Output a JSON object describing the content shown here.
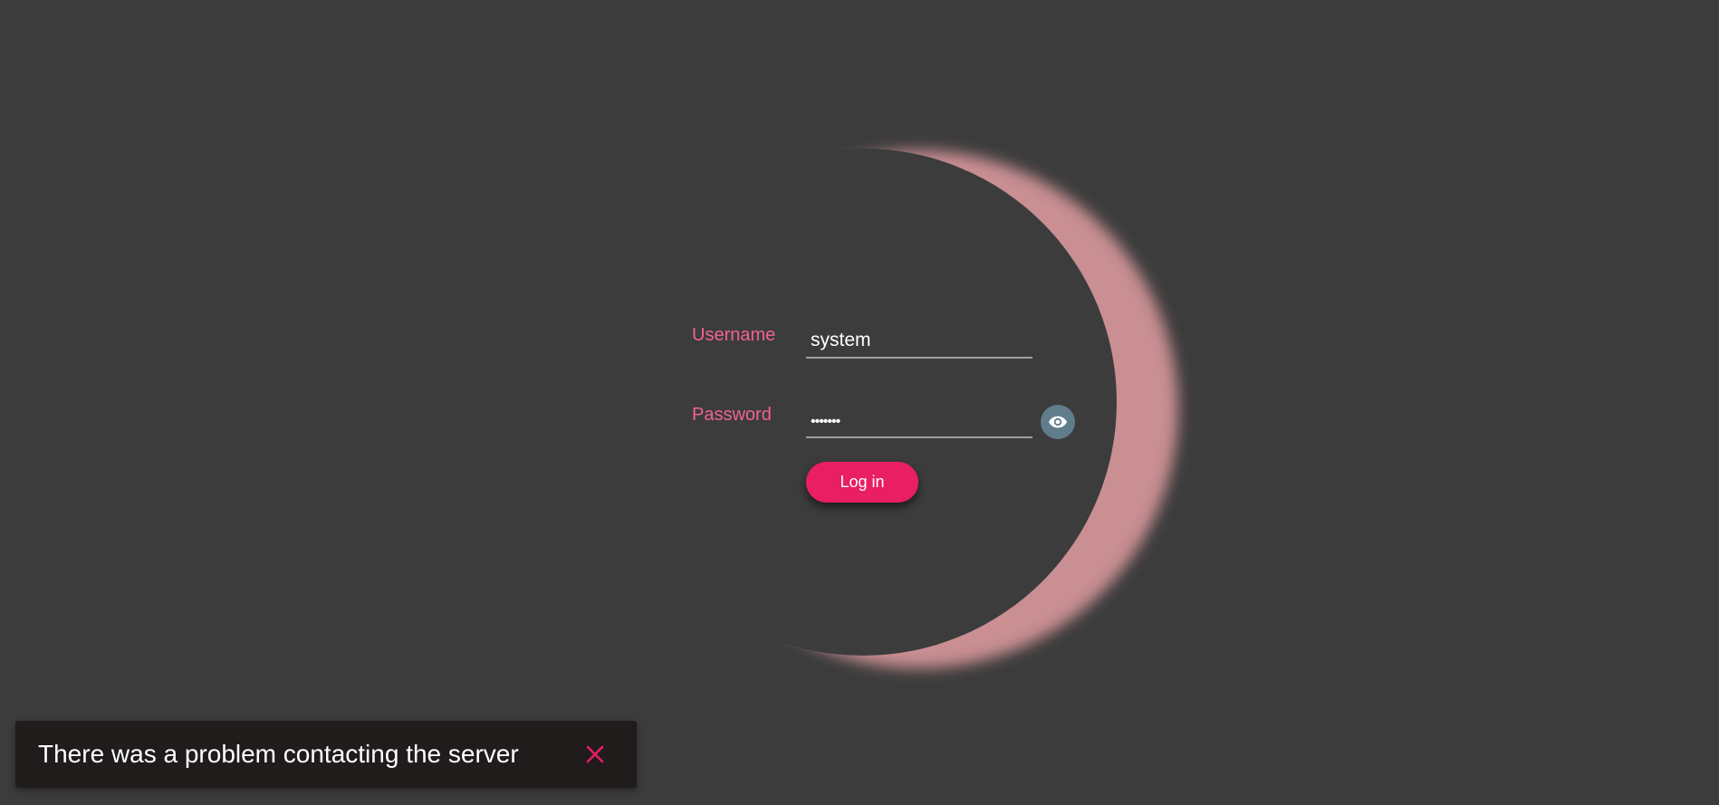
{
  "login_form": {
    "username_label": "Username",
    "username_value": "system",
    "password_label": "Password",
    "password_value": "•••••••",
    "toggle_visibility_icon": "eye-icon",
    "login_label": "Log in"
  },
  "snackbar": {
    "message": "There was a problem contacting the server",
    "close_icon": "close-icon"
  },
  "colors": {
    "background": "#3c3c3c",
    "accent": "#e91e63",
    "label": "#f06292",
    "glow": "#c98f93",
    "eye_button": "#607d8b",
    "snackbar_bg": "#201c1c"
  }
}
